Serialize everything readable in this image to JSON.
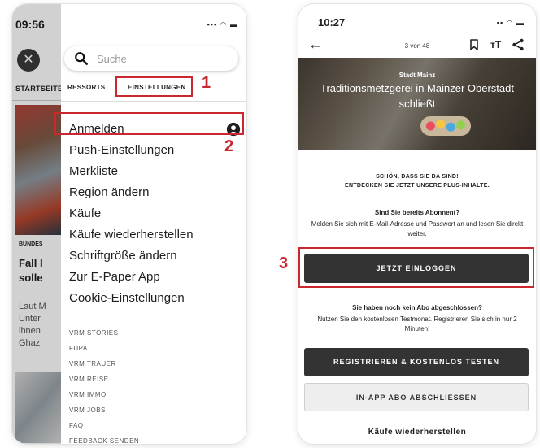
{
  "left": {
    "status_time": "09:56",
    "close_label": "✕",
    "background_tab": "STARTSEITE",
    "background_kicker": "BUNDES",
    "background_headline": "Fall I\nsolle",
    "background_teaser": "Laut M\nUnter\nihnen\nGhazi",
    "search_placeholder": "Suche",
    "tabs": [
      {
        "label": "RESSORTS"
      },
      {
        "label": "EINSTELLUNGEN"
      }
    ],
    "menu_items": [
      {
        "label": "Anmelden"
      },
      {
        "label": "Push-Einstellungen"
      },
      {
        "label": "Merkliste"
      },
      {
        "label": "Region ändern"
      },
      {
        "label": "Käufe"
      },
      {
        "label": "Käufe wiederherstellen"
      },
      {
        "label": "Schriftgröße ändern"
      },
      {
        "label": "Zur E-Paper App"
      },
      {
        "label": "Cookie-Einstellungen"
      }
    ],
    "sub_items": [
      {
        "label": "VRM STORIES"
      },
      {
        "label": "FUPA"
      },
      {
        "label": "VRM TRAUER"
      },
      {
        "label": "VRM REISE"
      },
      {
        "label": "VRM IMMO"
      },
      {
        "label": "VRM JOBS"
      },
      {
        "label": "FAQ"
      },
      {
        "label": "FEEDBACK SENDEN"
      }
    ]
  },
  "right": {
    "status_time": "10:27",
    "back_label": "←",
    "page_indicator": "3 von 48",
    "textsize_label": "тT",
    "hero_kicker": "Stadt Mainz",
    "hero_title": "Traditionsmetzgerei in Mainzer Oberstadt schließt",
    "welcome_text": "SCHÖN, DASS SIE DA SIND!\nENTDECKEN SIE JETZT UNSERE PLUS-INHALTE.",
    "subscriber_question": "Sind Sie bereits Abonnent?",
    "subscriber_text": "Melden Sie sich mit E-Mail-Adresse und Passwort an und lesen Sie direkt weiter.",
    "login_button": "JETZT EINLOGGEN",
    "no_subscription_question": "Sie haben noch kein Abo abgeschlossen?",
    "no_subscription_text": "Nutzen Sie den kostenlosen Testmonat. Registrieren Sie sich in nur 2 Minuten!",
    "register_button": "REGISTRIEREN & KOSTENLOS TESTEN",
    "inapp_button": "IN-APP ABO ABSCHLIESSEN",
    "restore_link": "Käufe wiederherstellen"
  },
  "annotations": [
    "1",
    "2",
    "3"
  ],
  "colors": {
    "annotation": "#c8282e",
    "button_dark": "#333333"
  },
  "icons": [
    "search-icon",
    "user-circle-icon",
    "back-arrow-icon",
    "bookmark-icon",
    "text-size-icon",
    "share-icon",
    "close-icon"
  ]
}
